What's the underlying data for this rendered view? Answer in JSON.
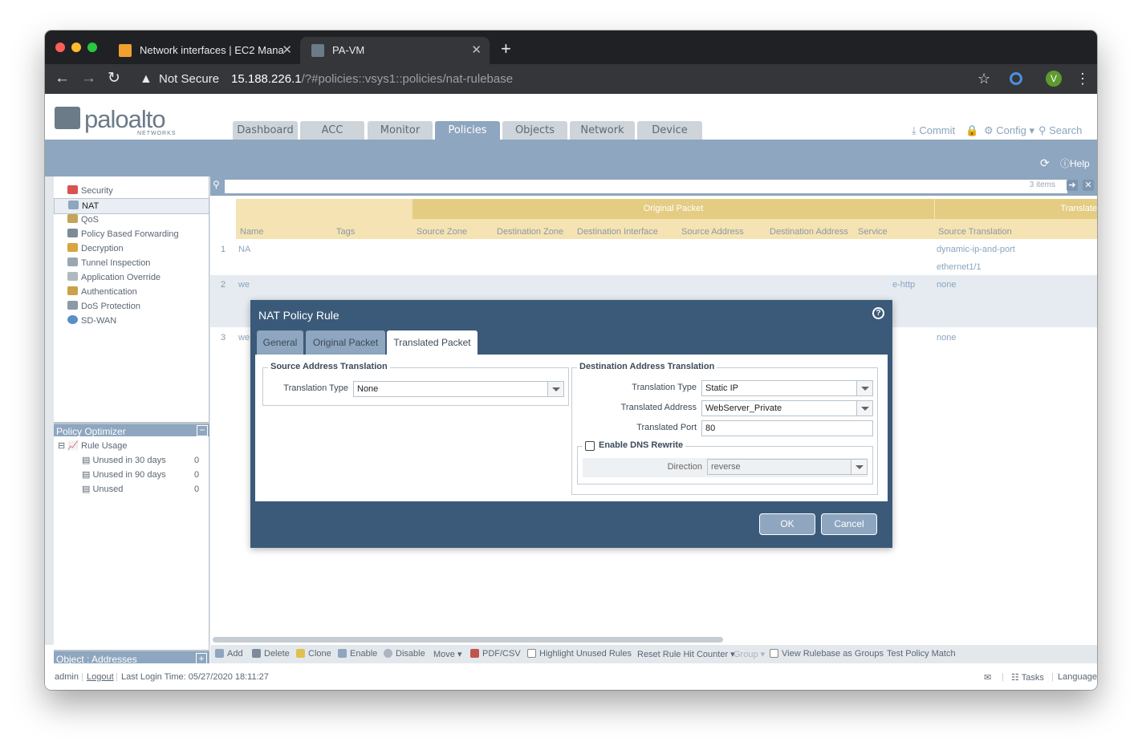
{
  "browser": {
    "tabs": [
      {
        "title": "Network interfaces | EC2 Mana",
        "active": false
      },
      {
        "title": "PA-VM",
        "active": true
      }
    ],
    "warning_text": "Not Secure",
    "url_host": "15.188.226.1",
    "url_path": "/?#policies::vsys1::policies/nat-rulebase",
    "profile_initial": "V"
  },
  "app": {
    "logo_text": "paloalto",
    "logo_sub": "NETWORKS",
    "main_tabs": [
      "Dashboard",
      "ACC",
      "Monitor",
      "Policies",
      "Objects",
      "Network",
      "Device"
    ],
    "active_tab": "Policies",
    "header_actions": {
      "commit": "Commit",
      "config": "Config",
      "search": "Search"
    },
    "help": "Help"
  },
  "sidebar": {
    "items": [
      {
        "label": "Security",
        "icon": "security-icon"
      },
      {
        "label": "NAT",
        "icon": "nat-icon"
      },
      {
        "label": "QoS",
        "icon": "qos-icon"
      },
      {
        "label": "Policy Based Forwarding",
        "icon": "pbf-icon"
      },
      {
        "label": "Decryption",
        "icon": "decryption-icon"
      },
      {
        "label": "Tunnel Inspection",
        "icon": "tunnel-icon"
      },
      {
        "label": "Application Override",
        "icon": "app-override-icon"
      },
      {
        "label": "Authentication",
        "icon": "authentication-icon"
      },
      {
        "label": "DoS Protection",
        "icon": "dos-icon"
      },
      {
        "label": "SD-WAN",
        "icon": "sdwan-icon"
      }
    ],
    "optimizer": {
      "title": "Policy Optimizer",
      "rule_usage": "Rule Usage",
      "items": [
        {
          "label": "Unused in 30 days",
          "count": "0"
        },
        {
          "label": "Unused in 90 days",
          "count": "0"
        },
        {
          "label": "Unused",
          "count": "0"
        }
      ]
    },
    "object_bar": "Object : Addresses"
  },
  "grid": {
    "items_count": "3 items",
    "group_original": "Original Packet",
    "group_translated": "Translate",
    "columns": [
      "Name",
      "Tags",
      "Source Zone",
      "Destination Zone",
      "Destination Interface",
      "Source Address",
      "Destination Address",
      "Service",
      "Source Translation"
    ],
    "rows": [
      {
        "num": "1",
        "name": "NA",
        "service": "",
        "src_trans": "dynamic-ip-and-port",
        "src_trans2": "ethernet1/1"
      },
      {
        "num": "2",
        "name": "we",
        "service": "e-http",
        "src_trans": "none",
        "src_trans2": ""
      },
      {
        "num": "3",
        "name": "we",
        "service": "",
        "src_trans": "none",
        "src_trans2": ""
      }
    ]
  },
  "toolbar": {
    "add": "Add",
    "delete": "Delete",
    "clone": "Clone",
    "enable": "Enable",
    "disable": "Disable",
    "move": "Move",
    "pdf": "PDF/CSV",
    "highlight": "Highlight Unused Rules",
    "reset": "Reset Rule Hit Counter",
    "group": "Group",
    "view_groups": "View Rulebase as Groups",
    "test": "Test Policy Match"
  },
  "status": {
    "user": "admin",
    "logout": "Logout",
    "last_login": "Last Login Time: 05/27/2020 18:11:27",
    "tasks": "Tasks",
    "language": "Language"
  },
  "dialog": {
    "title": "NAT Policy Rule",
    "tabs": [
      "General",
      "Original Packet",
      "Translated Packet"
    ],
    "active_tab": "Translated Packet",
    "src_section": "Source Address Translation",
    "src_type_label": "Translation Type",
    "src_type_value": "None",
    "dst_section": "Destination Address Translation",
    "dst_type_label": "Translation Type",
    "dst_type_value": "Static IP",
    "translated_address_label": "Translated Address",
    "translated_address_value": "WebServer_Private",
    "translated_port_label": "Translated Port",
    "translated_port_value": "80",
    "dns_rewrite_label": "Enable DNS Rewrite",
    "direction_label": "Direction",
    "direction_value": "reverse",
    "ok": "OK",
    "cancel": "Cancel"
  }
}
